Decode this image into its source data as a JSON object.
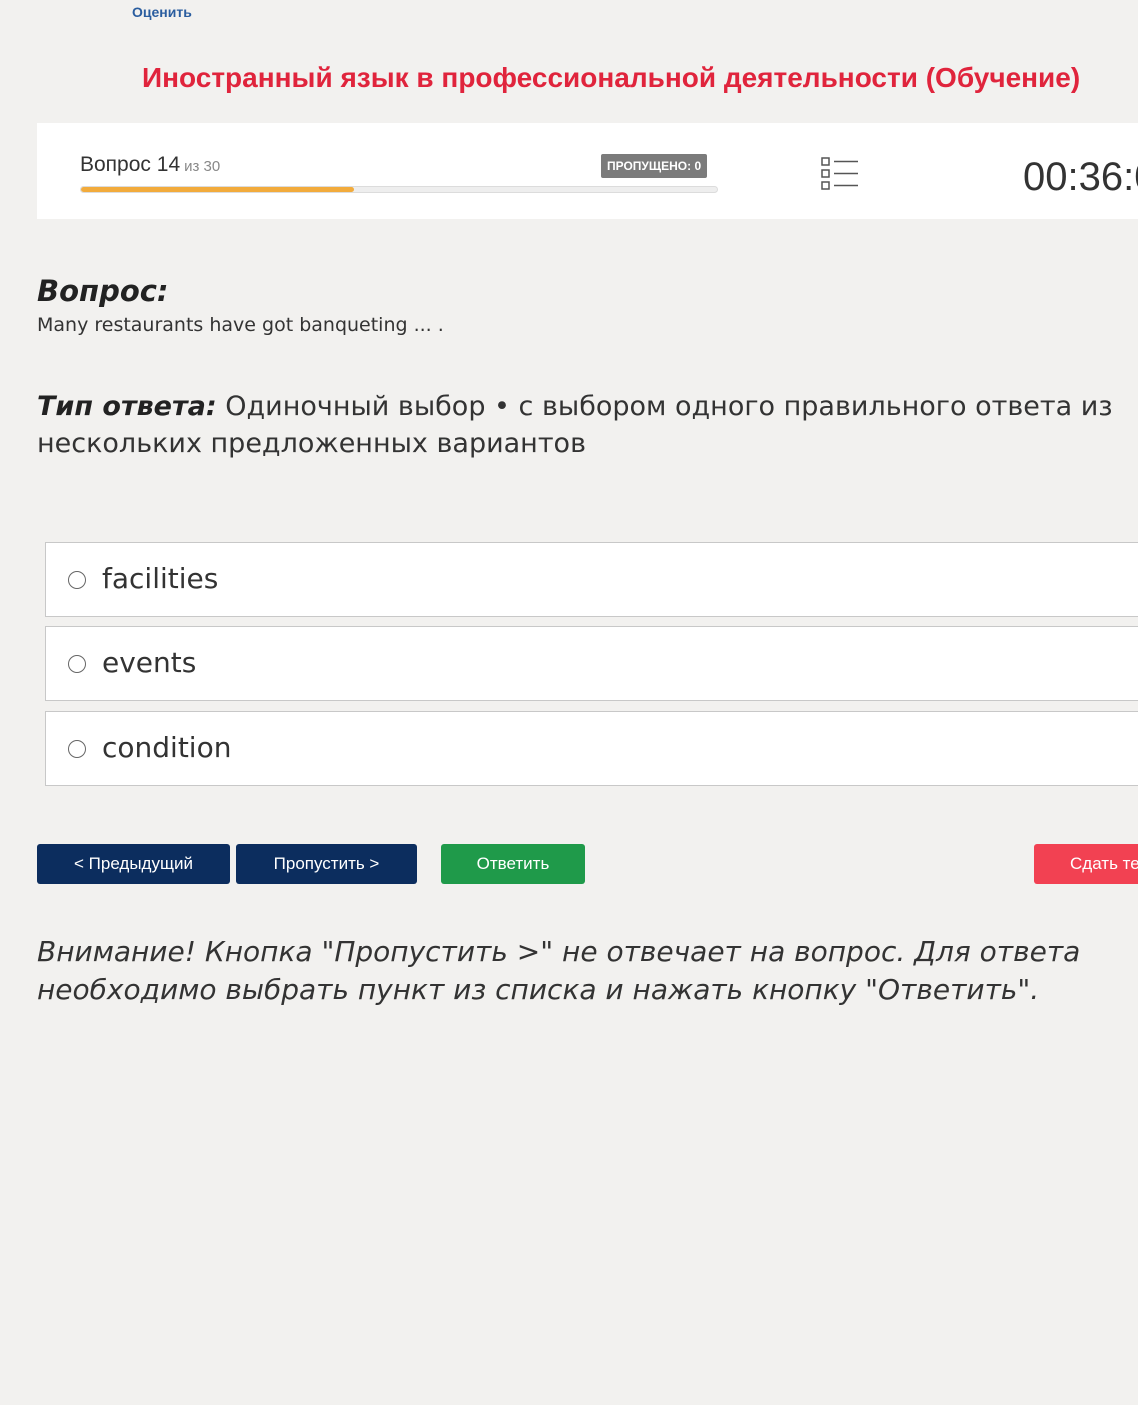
{
  "header": {
    "rate_link": "Оценить",
    "course_title": "Иностранный язык в профессиональной деятельности (Обучение)"
  },
  "progress": {
    "question_prefix": "Вопрос",
    "current": "14",
    "total_label": "из 30",
    "fraction": 0.43,
    "skipped_label": "ПРОПУЩЕНО: 0",
    "timer": "00:36:0"
  },
  "question": {
    "label": "Вопрос:",
    "text": "Many restaurants have got banqueting ... ."
  },
  "answer_type": {
    "label": "Тип ответа:",
    "text": " Одиночный выбор • с выбором одного правильного ответа из нескольких предложенных вариантов"
  },
  "options": [
    {
      "label": "facilities"
    },
    {
      "label": "events"
    },
    {
      "label": "condition"
    }
  ],
  "buttons": {
    "prev": "< Предыдущий",
    "skip": "Пропустить >",
    "answer": "Ответить",
    "submit": "Сдать те"
  },
  "colors": {
    "accent_red": "#e0243c",
    "nav_blue": "#0c2d5e",
    "answer_green": "#1f9a4a",
    "submit_red": "#f24152",
    "progress_orange": "#f2ab3c"
  },
  "warning": "Внимание! Кнопка \"Пропустить >\" не отвечает на вопрос. Для ответа необходимо выбрать пункт из списка и нажать кнопку \"Ответить\"."
}
